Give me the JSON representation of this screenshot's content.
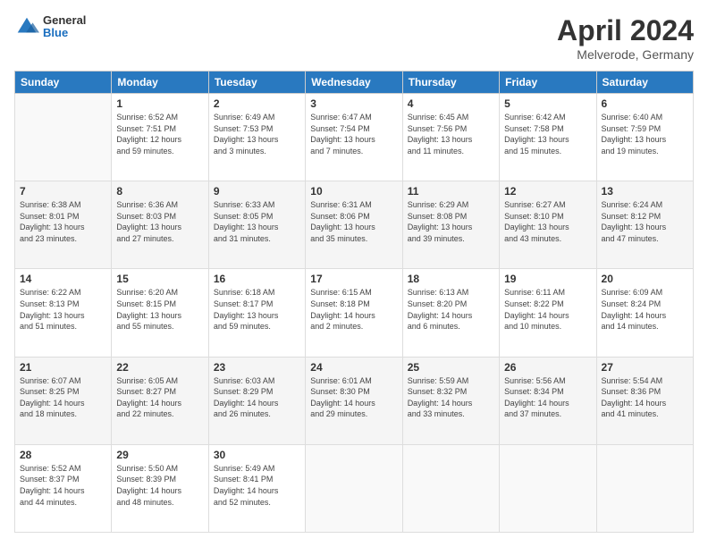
{
  "header": {
    "logo": {
      "general": "General",
      "blue": "Blue"
    },
    "title": "April 2024",
    "location": "Melverode, Germany"
  },
  "calendar": {
    "days_of_week": [
      "Sunday",
      "Monday",
      "Tuesday",
      "Wednesday",
      "Thursday",
      "Friday",
      "Saturday"
    ],
    "weeks": [
      [
        {
          "day": "",
          "info": ""
        },
        {
          "day": "1",
          "info": "Sunrise: 6:52 AM\nSunset: 7:51 PM\nDaylight: 12 hours\nand 59 minutes."
        },
        {
          "day": "2",
          "info": "Sunrise: 6:49 AM\nSunset: 7:53 PM\nDaylight: 13 hours\nand 3 minutes."
        },
        {
          "day": "3",
          "info": "Sunrise: 6:47 AM\nSunset: 7:54 PM\nDaylight: 13 hours\nand 7 minutes."
        },
        {
          "day": "4",
          "info": "Sunrise: 6:45 AM\nSunset: 7:56 PM\nDaylight: 13 hours\nand 11 minutes."
        },
        {
          "day": "5",
          "info": "Sunrise: 6:42 AM\nSunset: 7:58 PM\nDaylight: 13 hours\nand 15 minutes."
        },
        {
          "day": "6",
          "info": "Sunrise: 6:40 AM\nSunset: 7:59 PM\nDaylight: 13 hours\nand 19 minutes."
        }
      ],
      [
        {
          "day": "7",
          "info": "Sunrise: 6:38 AM\nSunset: 8:01 PM\nDaylight: 13 hours\nand 23 minutes."
        },
        {
          "day": "8",
          "info": "Sunrise: 6:36 AM\nSunset: 8:03 PM\nDaylight: 13 hours\nand 27 minutes."
        },
        {
          "day": "9",
          "info": "Sunrise: 6:33 AM\nSunset: 8:05 PM\nDaylight: 13 hours\nand 31 minutes."
        },
        {
          "day": "10",
          "info": "Sunrise: 6:31 AM\nSunset: 8:06 PM\nDaylight: 13 hours\nand 35 minutes."
        },
        {
          "day": "11",
          "info": "Sunrise: 6:29 AM\nSunset: 8:08 PM\nDaylight: 13 hours\nand 39 minutes."
        },
        {
          "day": "12",
          "info": "Sunrise: 6:27 AM\nSunset: 8:10 PM\nDaylight: 13 hours\nand 43 minutes."
        },
        {
          "day": "13",
          "info": "Sunrise: 6:24 AM\nSunset: 8:12 PM\nDaylight: 13 hours\nand 47 minutes."
        }
      ],
      [
        {
          "day": "14",
          "info": "Sunrise: 6:22 AM\nSunset: 8:13 PM\nDaylight: 13 hours\nand 51 minutes."
        },
        {
          "day": "15",
          "info": "Sunrise: 6:20 AM\nSunset: 8:15 PM\nDaylight: 13 hours\nand 55 minutes."
        },
        {
          "day": "16",
          "info": "Sunrise: 6:18 AM\nSunset: 8:17 PM\nDaylight: 13 hours\nand 59 minutes."
        },
        {
          "day": "17",
          "info": "Sunrise: 6:15 AM\nSunset: 8:18 PM\nDaylight: 14 hours\nand 2 minutes."
        },
        {
          "day": "18",
          "info": "Sunrise: 6:13 AM\nSunset: 8:20 PM\nDaylight: 14 hours\nand 6 minutes."
        },
        {
          "day": "19",
          "info": "Sunrise: 6:11 AM\nSunset: 8:22 PM\nDaylight: 14 hours\nand 10 minutes."
        },
        {
          "day": "20",
          "info": "Sunrise: 6:09 AM\nSunset: 8:24 PM\nDaylight: 14 hours\nand 14 minutes."
        }
      ],
      [
        {
          "day": "21",
          "info": "Sunrise: 6:07 AM\nSunset: 8:25 PM\nDaylight: 14 hours\nand 18 minutes."
        },
        {
          "day": "22",
          "info": "Sunrise: 6:05 AM\nSunset: 8:27 PM\nDaylight: 14 hours\nand 22 minutes."
        },
        {
          "day": "23",
          "info": "Sunrise: 6:03 AM\nSunset: 8:29 PM\nDaylight: 14 hours\nand 26 minutes."
        },
        {
          "day": "24",
          "info": "Sunrise: 6:01 AM\nSunset: 8:30 PM\nDaylight: 14 hours\nand 29 minutes."
        },
        {
          "day": "25",
          "info": "Sunrise: 5:59 AM\nSunset: 8:32 PM\nDaylight: 14 hours\nand 33 minutes."
        },
        {
          "day": "26",
          "info": "Sunrise: 5:56 AM\nSunset: 8:34 PM\nDaylight: 14 hours\nand 37 minutes."
        },
        {
          "day": "27",
          "info": "Sunrise: 5:54 AM\nSunset: 8:36 PM\nDaylight: 14 hours\nand 41 minutes."
        }
      ],
      [
        {
          "day": "28",
          "info": "Sunrise: 5:52 AM\nSunset: 8:37 PM\nDaylight: 14 hours\nand 44 minutes."
        },
        {
          "day": "29",
          "info": "Sunrise: 5:50 AM\nSunset: 8:39 PM\nDaylight: 14 hours\nand 48 minutes."
        },
        {
          "day": "30",
          "info": "Sunrise: 5:49 AM\nSunset: 8:41 PM\nDaylight: 14 hours\nand 52 minutes."
        },
        {
          "day": "",
          "info": ""
        },
        {
          "day": "",
          "info": ""
        },
        {
          "day": "",
          "info": ""
        },
        {
          "day": "",
          "info": ""
        }
      ]
    ]
  }
}
